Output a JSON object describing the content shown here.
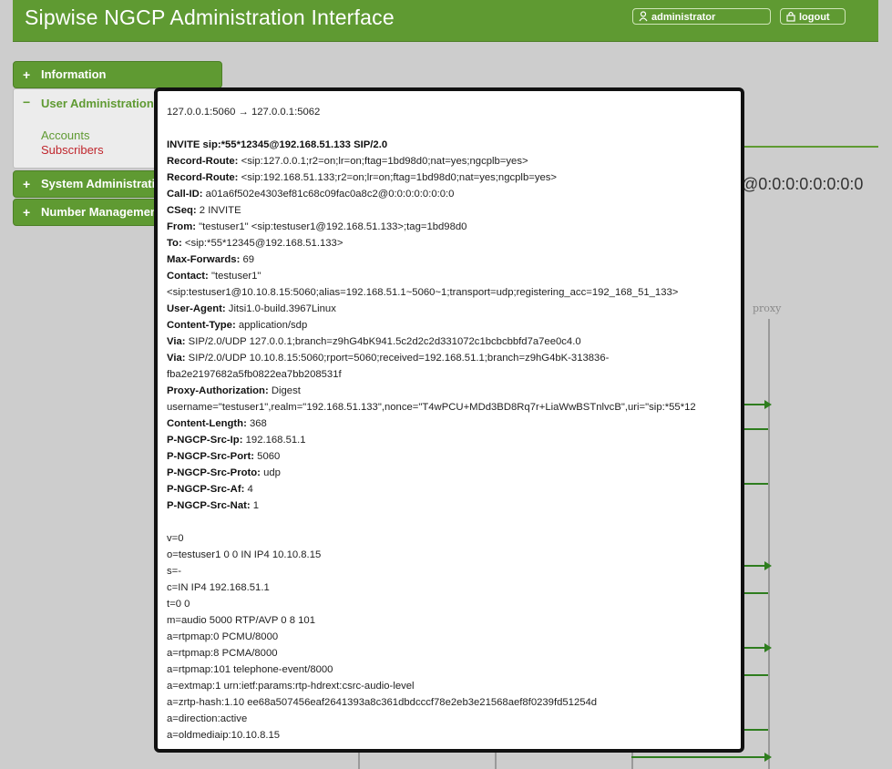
{
  "header": {
    "title": "Sipwise NGCP Administration Interface",
    "user_label": "administrator",
    "logout_label": "logout"
  },
  "sidebar": {
    "items": [
      {
        "sign": "+",
        "label": "Information"
      },
      {
        "sign": "−",
        "label": "User Administration",
        "children": [
          "Accounts",
          "Subscribers"
        ]
      },
      {
        "sign": "+",
        "label": "System Administration"
      },
      {
        "sign": "+",
        "label": "Number Management"
      }
    ]
  },
  "background": {
    "call_id_fragment": "@0:0:0:0:0:0:0:0",
    "lane_label": "proxy"
  },
  "colors": {
    "brand_green": "#5f9a32",
    "active_link_red": "#c0262d",
    "arrow_green": "#2e7d1e"
  },
  "message": {
    "route": "127.0.0.1:5060 → 127.0.0.1:5062",
    "request_line": "INVITE sip:*55*12345@192.168.51.133 SIP/2.0",
    "headers": [
      {
        "name": "Record-Route:",
        "value": " <sip:127.0.0.1;r2=on;lr=on;ftag=1bd98d0;nat=yes;ngcplb=yes>"
      },
      {
        "name": "Record-Route:",
        "value": " <sip:192.168.51.133;r2=on;lr=on;ftag=1bd98d0;nat=yes;ngcplb=yes>"
      },
      {
        "name": "Call-ID:",
        "value": " a01a6f502e4303ef81c68c09fac0a8c2@0:0:0:0:0:0:0:0"
      },
      {
        "name": "CSeq:",
        "value": " 2 INVITE"
      },
      {
        "name": "From:",
        "value": " \"testuser1\" <sip:testuser1@192.168.51.133>;tag=1bd98d0"
      },
      {
        "name": "To:",
        "value": " <sip:*55*12345@192.168.51.133>"
      },
      {
        "name": "Max-Forwards:",
        "value": " 69"
      },
      {
        "name": "Contact:",
        "value": " \"testuser1\""
      },
      {
        "name": "",
        "value": "<sip:testuser1@10.10.8.15:5060;alias=192.168.51.1~5060~1;transport=udp;registering_acc=192_168_51_133>"
      },
      {
        "name": "User-Agent:",
        "value": " Jitsi1.0-build.3967Linux"
      },
      {
        "name": "Content-Type:",
        "value": " application/sdp"
      },
      {
        "name": "Via:",
        "value": " SIP/2.0/UDP 127.0.0.1;branch=z9hG4bK941.5c2d2c2d331072c1bcbcbbfd7a7ee0c4.0"
      },
      {
        "name": "Via:",
        "value": " SIP/2.0/UDP 10.10.8.15:5060;rport=5060;received=192.168.51.1;branch=z9hG4bK-313836-"
      },
      {
        "name": "",
        "value": "fba2e2197682a5fb0822ea7bb208531f"
      },
      {
        "name": "Proxy-Authorization:",
        "value": " Digest"
      },
      {
        "name": "",
        "value": "username=\"testuser1\",realm=\"192.168.51.133\",nonce=\"T4wPCU+MDd3BD8Rq7r+LiaWwBSTnlvcB\",uri=\"sip:*55*12"
      },
      {
        "name": "Content-Length:",
        "value": " 368"
      },
      {
        "name": "P-NGCP-Src-Ip:",
        "value": " 192.168.51.1"
      },
      {
        "name": "P-NGCP-Src-Port:",
        "value": " 5060"
      },
      {
        "name": "P-NGCP-Src-Proto:",
        "value": " udp"
      },
      {
        "name": "P-NGCP-Src-Af:",
        "value": " 4"
      },
      {
        "name": "P-NGCP-Src-Nat:",
        "value": " 1"
      }
    ],
    "sdp": [
      "v=0",
      "o=testuser1 0 0 IN IP4 10.10.8.15",
      "s=-",
      "c=IN IP4 192.168.51.1",
      "t=0 0",
      "m=audio 5000 RTP/AVP 0 8 101",
      "a=rtpmap:0 PCMU/8000",
      "a=rtpmap:8 PCMA/8000",
      "a=rtpmap:101 telephone-event/8000",
      "a=extmap:1 urn:ietf:params:rtp-hdrext:csrc-audio-level",
      "a=zrtp-hash:1.10 ee68a507456eaf2641393a8c361dbdcccf78e2eb3e21568aef8f0239fd51254d",
      "a=direction:active",
      "a=oldmediaip:10.10.8.15"
    ]
  }
}
